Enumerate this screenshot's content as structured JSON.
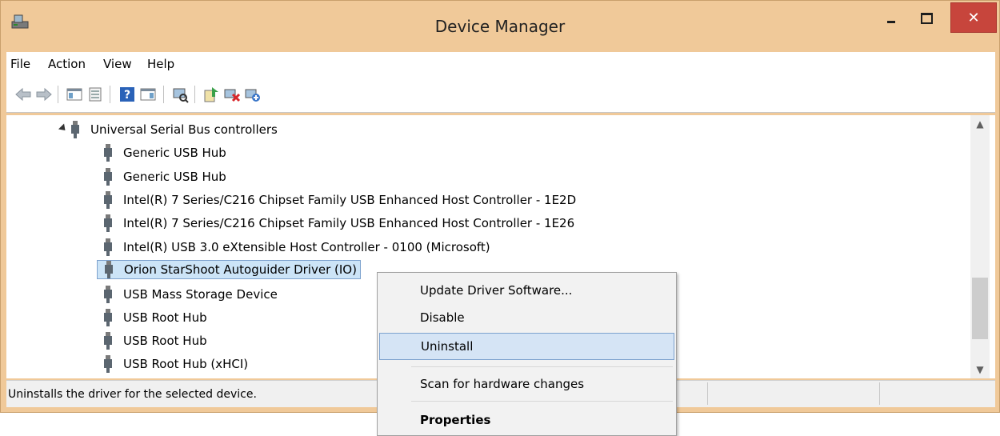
{
  "window": {
    "title": "Device Manager",
    "close_glyph": "✕"
  },
  "menu": {
    "items": [
      "File",
      "Action",
      "View",
      "Help"
    ]
  },
  "toolbar": {
    "icons": [
      "back-arrow-icon",
      "forward-arrow-icon",
      "show-hide-console-tree-icon",
      "properties-icon",
      "help-icon",
      "show-action-pane-icon",
      "scan-hardware-icon",
      "update-driver-icon",
      "uninstall-device-icon",
      "enable-device-icon"
    ]
  },
  "tree": {
    "category": "Universal Serial Bus controllers",
    "items": [
      "Generic USB Hub",
      "Generic USB Hub",
      "Intel(R) 7 Series/C216 Chipset Family USB Enhanced Host Controller - 1E2D",
      "Intel(R) 7 Series/C216 Chipset Family USB Enhanced Host Controller - 1E26",
      "Intel(R) USB 3.0 eXtensible Host Controller - 0100 (Microsoft)",
      "Orion StarShoot Autoguider Driver (IO)",
      "USB Mass Storage Device",
      "USB Root Hub",
      "USB Root Hub",
      "USB Root Hub (xHCI)"
    ],
    "selected_index": 5
  },
  "status": {
    "text": "Uninstalls the driver for the selected device."
  },
  "context_menu": {
    "items": [
      {
        "label": "Update Driver Software...",
        "highlighted": false
      },
      {
        "label": "Disable",
        "highlighted": false
      },
      {
        "label": "Uninstall",
        "highlighted": true
      },
      {
        "label": "Scan for hardware changes",
        "highlighted": false
      },
      {
        "label": "Properties",
        "bold": true
      }
    ]
  },
  "colors": {
    "frame": "#f0c999",
    "close_button": "#c7453c",
    "selection": "#cce4f7",
    "menu_highlight": "#d5e4f5"
  }
}
